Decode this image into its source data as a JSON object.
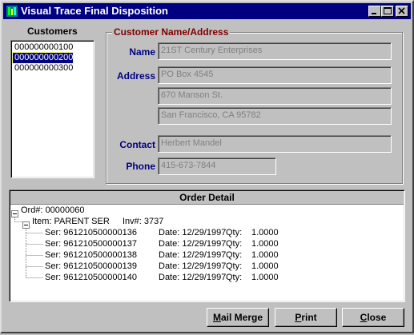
{
  "window": {
    "title": "Visual Trace Final Disposition",
    "controls": [
      "minimize-icon",
      "maximize-icon",
      "close-icon"
    ]
  },
  "customers": {
    "label": "Customers",
    "items": [
      "000000000100",
      "000000000200",
      "000000000300"
    ],
    "selected_index": 1
  },
  "customer_info": {
    "group_label": "Customer Name/Address",
    "group_label_color": "#800000",
    "name_label": "Name",
    "name_value": "21ST Century Enterprises",
    "address_label": "Address",
    "address_lines": [
      "PO Box 4545",
      "670 Manson St.",
      "San Francisco,  CA   95782"
    ],
    "contact_label": "Contact",
    "contact_value": "Herbert Mandel",
    "phone_label": "Phone",
    "phone_value": "415-673-7844"
  },
  "order_detail": {
    "header": "Order Detail",
    "order_line": "Ord#: 00000060",
    "item_line": "Item: PARENT SER",
    "inv_line": "Inv#: 3737",
    "serials": [
      {
        "ser": "Ser: 961210500000136",
        "date": "Date: 12/29/1997",
        "qty_label": "Qty:",
        "qty": "1.0000"
      },
      {
        "ser": "Ser: 961210500000137",
        "date": "Date: 12/29/1997",
        "qty_label": "Qty:",
        "qty": "1.0000"
      },
      {
        "ser": "Ser: 961210500000138",
        "date": "Date: 12/29/1997",
        "qty_label": "Qty:",
        "qty": "1.0000"
      },
      {
        "ser": "Ser: 961210500000139",
        "date": "Date: 12/29/1997",
        "qty_label": "Qty:",
        "qty": "1.0000"
      },
      {
        "ser": "Ser: 961210500000140",
        "date": "Date: 12/29/1997",
        "qty_label": "Qty:",
        "qty": "1.0000"
      }
    ]
  },
  "buttons": {
    "mail_merge": {
      "mnemonic": "M",
      "rest": "ail Merge"
    },
    "print": {
      "mnemonic": "P",
      "rest": "rint"
    },
    "close": {
      "mnemonic": "C",
      "rest": "lose"
    }
  },
  "colors": {
    "titlebar": "#000080",
    "label_blue": "#000080",
    "selection": "#000080",
    "face": "#c0c0c0"
  }
}
